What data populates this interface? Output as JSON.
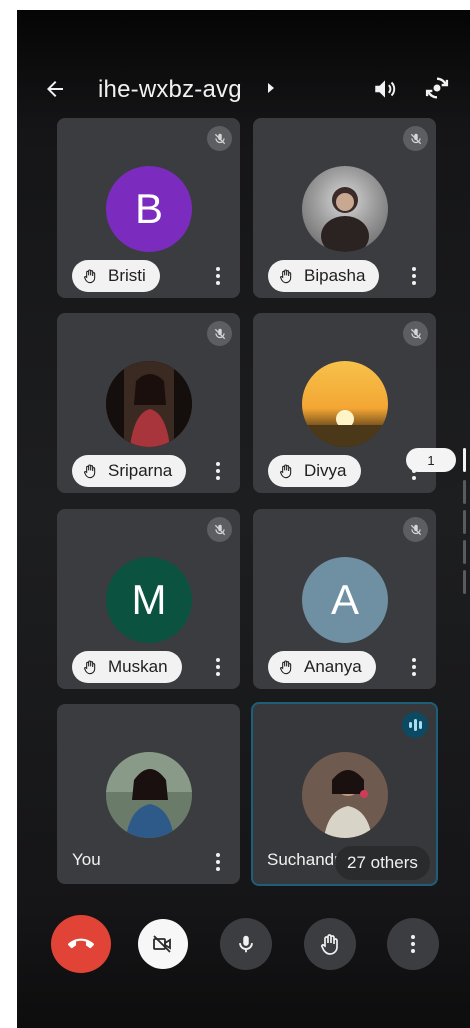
{
  "header": {
    "meeting_code": "ihe-wxbz-avg",
    "icons": [
      "back-arrow-icon",
      "chevron-right-icon",
      "speaker-icon",
      "switch-camera-icon"
    ]
  },
  "participants": [
    {
      "name": "Bristi",
      "initial": "B",
      "avatar_color": "#7b2cbf",
      "muted": true,
      "hand_raised": true
    },
    {
      "name": "Bipasha",
      "initial": "",
      "avatar_color": "#8a8a8a",
      "muted": true,
      "hand_raised": true
    },
    {
      "name": "Sriparna",
      "initial": "",
      "avatar_color": "#2a1a1a",
      "muted": true,
      "hand_raised": true
    },
    {
      "name": "Divya",
      "initial": "",
      "avatar_color": "#f2b13c",
      "muted": true,
      "hand_raised": true
    },
    {
      "name": "Muskan",
      "initial": "M",
      "avatar_color": "#0b5340",
      "muted": true,
      "hand_raised": true
    },
    {
      "name": "Ananya",
      "initial": "A",
      "avatar_color": "#6f8fa3",
      "muted": true,
      "hand_raised": true
    },
    {
      "name": "You",
      "initial": "",
      "avatar_color": "#4a6a5a",
      "muted": false,
      "hand_raised": false
    },
    {
      "name": "Suchandra",
      "display_name": "Suchandr",
      "initial": "",
      "avatar_color": "#5a4a40",
      "speaking": true
    }
  ],
  "others_badge": "27 others",
  "page_indicator": "1",
  "controls": {
    "end_call": "end-call-button",
    "camera": "camera-off-button",
    "mic": "microphone-button",
    "raise_hand": "raise-hand-button",
    "more": "more-options-button"
  },
  "colors": {
    "end_call": "#e14436",
    "tile_bg": "#3b3c3f",
    "speaking_border": "#1d5f79"
  }
}
